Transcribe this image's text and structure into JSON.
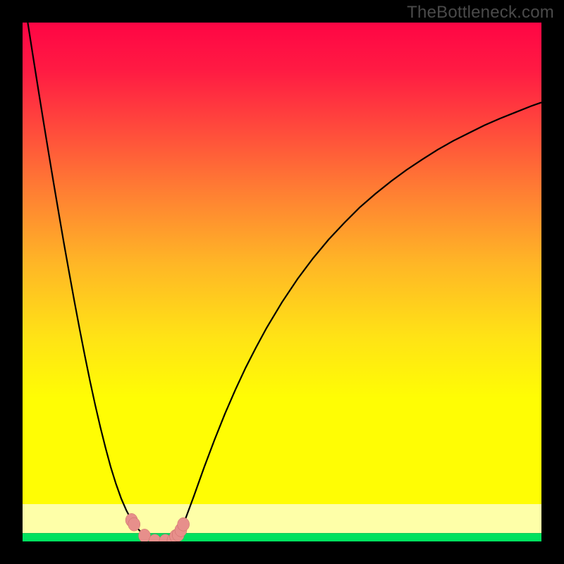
{
  "watermark": "TheBottleneck.com",
  "colors": {
    "frame": "#000000",
    "watermark": "#4a4a4a",
    "curve": "#000000",
    "marker_fill": "#e78f8b",
    "marker_stroke": "#c96a65",
    "band_pale": "#feffa8",
    "band_green": "#00e15e",
    "gradient_stops": [
      {
        "offset": 0.0,
        "color": "#ff0544"
      },
      {
        "offset": 0.1,
        "color": "#ff1b43"
      },
      {
        "offset": 0.22,
        "color": "#ff4a3c"
      },
      {
        "offset": 0.35,
        "color": "#ff7e33"
      },
      {
        "offset": 0.5,
        "color": "#ffb626"
      },
      {
        "offset": 0.65,
        "color": "#ffe216"
      },
      {
        "offset": 0.78,
        "color": "#fffd04"
      },
      {
        "offset": 1.0,
        "color": "#fffd04"
      }
    ]
  },
  "chart_data": {
    "type": "line",
    "title": "",
    "xlabel": "",
    "ylabel": "",
    "xlim": [
      0,
      100
    ],
    "ylim": [
      0,
      100
    ],
    "x": [
      1,
      2,
      3,
      4,
      5,
      6,
      7,
      8,
      9,
      10,
      11,
      12,
      13,
      14,
      15,
      16,
      17,
      18,
      19,
      20,
      21,
      22,
      23,
      24,
      25,
      26,
      27,
      28,
      29,
      30,
      31,
      33,
      35,
      37,
      39,
      41,
      43,
      45,
      47,
      50,
      53,
      56,
      59,
      62,
      65,
      68,
      71,
      74,
      77,
      80,
      83,
      86,
      89,
      92,
      95,
      98,
      100
    ],
    "values": [
      100,
      93.6,
      87.3,
      81.1,
      75.0,
      69.0,
      63.1,
      57.3,
      51.7,
      46.2,
      40.9,
      35.8,
      30.9,
      26.3,
      22.0,
      18.0,
      14.3,
      11.1,
      8.3,
      6.0,
      4.1,
      2.7,
      1.6,
      0.8,
      0.2,
      0.0,
      0.0,
      0.0,
      0.3,
      1.3,
      3.3,
      8.7,
      14.3,
      19.6,
      24.6,
      29.2,
      33.5,
      37.4,
      41.1,
      46.1,
      50.6,
      54.6,
      58.2,
      61.4,
      64.4,
      67.0,
      69.4,
      71.6,
      73.6,
      75.5,
      77.2,
      78.7,
      80.2,
      81.5,
      82.7,
      83.9,
      84.6
    ],
    "markers": [
      {
        "x": 21.0,
        "y": 4.1
      },
      {
        "x": 21.5,
        "y": 3.3
      },
      {
        "x": 23.5,
        "y": 1.1
      },
      {
        "x": 25.5,
        "y": 0.1
      },
      {
        "x": 27.5,
        "y": 0.1
      },
      {
        "x": 29.0,
        "y": 0.2
      },
      {
        "x": 29.5,
        "y": 1.0
      },
      {
        "x": 30.0,
        "y": 1.3
      },
      {
        "x": 30.5,
        "y": 2.2
      },
      {
        "x": 31.0,
        "y": 3.3
      }
    ]
  }
}
